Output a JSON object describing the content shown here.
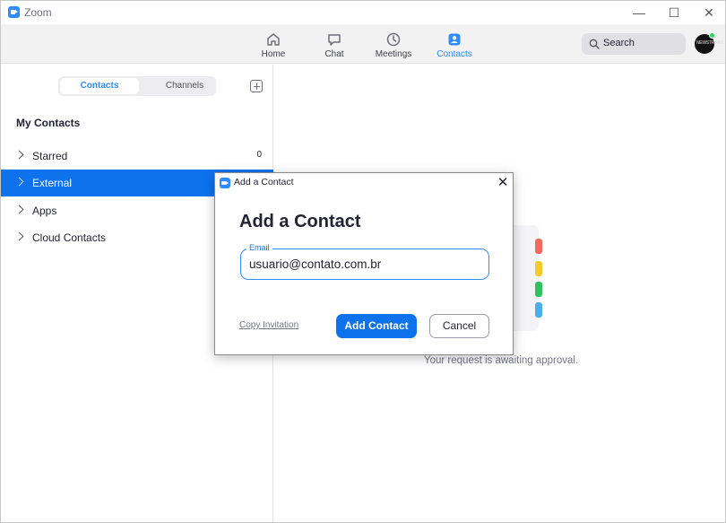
{
  "window": {
    "app_title": "Zoom",
    "minimize_glyph": "—",
    "maximize_glyph": "☐",
    "close_glyph": "✕"
  },
  "toolbar": {
    "tabs": [
      {
        "label": "Home",
        "icon": "home-icon",
        "active": false
      },
      {
        "label": "Chat",
        "icon": "chat-icon",
        "active": false
      },
      {
        "label": "Meetings",
        "icon": "clock-icon",
        "active": false
      },
      {
        "label": "Contacts",
        "icon": "contacts-icon",
        "active": true
      }
    ],
    "search_label": "Search",
    "avatar_text": "NEWSTREAM",
    "presence": "online"
  },
  "sidebar": {
    "segments": [
      "Contacts",
      "Channels"
    ],
    "active_segment": "Contacts",
    "section_title": "My Contacts",
    "items": [
      {
        "label": "Starred",
        "count": "0",
        "selected": false
      },
      {
        "label": "External",
        "count": "",
        "selected": true
      },
      {
        "label": "Apps",
        "count": "",
        "selected": false
      },
      {
        "label": "Cloud Contacts",
        "count": "",
        "selected": false
      }
    ]
  },
  "main": {
    "status_text": "Your request is awaiting approval."
  },
  "dialog": {
    "window_title": "Add a Contact",
    "heading": "Add a Contact",
    "email_label": "Email",
    "email_value": "usuario@contato.com.br",
    "copy_invitation": "Copy Invitation",
    "primary_button": "Add Contact",
    "secondary_button": "Cancel"
  },
  "colors": {
    "accent": "#0e72ed",
    "link_blue": "#2d8cff",
    "selected_row": "#0e72ed",
    "presence_green": "#23d959",
    "illus_red": "#f36a5a",
    "illus_yellow": "#f7c82a",
    "illus_green": "#2fc25b",
    "illus_blue": "#4ab0ec"
  }
}
